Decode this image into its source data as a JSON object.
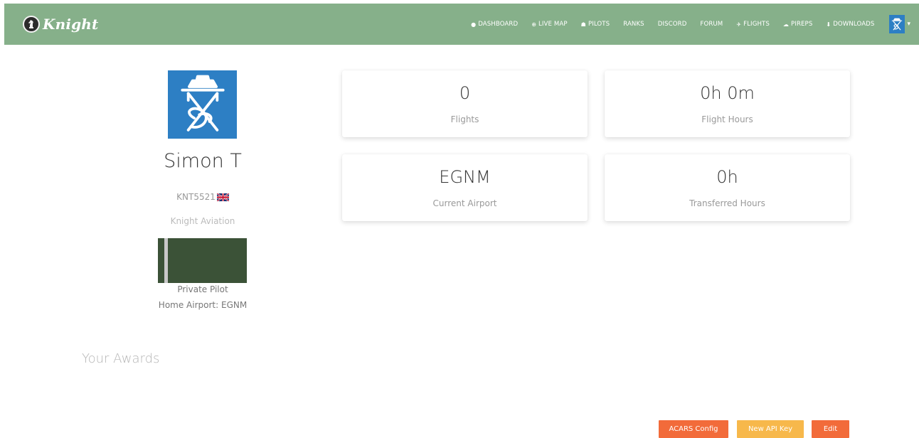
{
  "brand": {
    "name": "Knight"
  },
  "nav": {
    "items": [
      {
        "icon": "dashboard-icon",
        "glyph": "●",
        "label": "DASHBOARD"
      },
      {
        "icon": "globe-icon",
        "glyph": "⊕",
        "label": "LIVE MAP"
      },
      {
        "icon": "users-icon",
        "glyph": "☗",
        "label": "PILOTS"
      },
      {
        "icon": "",
        "glyph": "",
        "label": "RANKS"
      },
      {
        "icon": "",
        "glyph": "",
        "label": "DISCORD"
      },
      {
        "icon": "",
        "glyph": "",
        "label": "FORUM"
      },
      {
        "icon": "flights-icon",
        "glyph": "✈",
        "label": "FLIGHTS"
      },
      {
        "icon": "cloud-upload-icon",
        "glyph": "☁",
        "label": "PIREPS"
      },
      {
        "icon": "download-icon",
        "glyph": "⬇",
        "label": "DOWNLOADS"
      }
    ],
    "user_caret": "▾"
  },
  "profile": {
    "name": "Simon T",
    "pilot_id": "KNT5521",
    "country_flag": "flag-uk-icon",
    "airline": "Knight Aviation",
    "rank": "Private Pilot",
    "home_airport": "Home Airport: EGNM"
  },
  "stats": {
    "flights": {
      "value": "0",
      "label": "Flights"
    },
    "flight_hours": {
      "value": "0h 0m",
      "label": "Flight Hours"
    },
    "current_airport": {
      "value": "EGNM",
      "label": "Current Airport"
    },
    "transferred_hours": {
      "value": "0h",
      "label": "Transferred Hours"
    }
  },
  "awards": {
    "title": "Your Awards"
  },
  "buttons": {
    "acars_config": "ACARS Config",
    "new_api_key": "New API Key",
    "edit": "Edit"
  },
  "colors": {
    "navbar": "#86b08a",
    "avatar_bg": "#2d7fc4",
    "acars_button": "#f26b3a",
    "api_key_button": "#f7b84b",
    "edit_button": "#f26b3a"
  }
}
